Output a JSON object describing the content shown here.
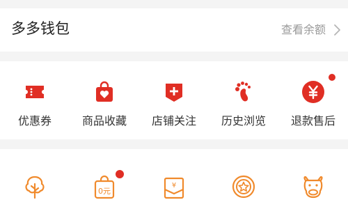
{
  "colors": {
    "brand_red": "#e02e24",
    "accent_orange": "#f08a2c",
    "background": "#f4f4f4",
    "text": "#333333",
    "muted": "#9a9a9a"
  },
  "wallet": {
    "title": "多多钱包",
    "link_label": "查看余额",
    "link_icon": "chevron-right-icon"
  },
  "shortcuts": [
    {
      "label": "优惠券",
      "icon": "coupon-icon",
      "badge": false
    },
    {
      "label": "商品收藏",
      "icon": "favorites-bag-icon",
      "badge": false
    },
    {
      "label": "店铺关注",
      "icon": "store-follow-icon",
      "badge": true
    },
    {
      "label": "历史浏览",
      "icon": "footprint-icon",
      "badge": false
    },
    {
      "label": "退款售后",
      "icon": "refund-yen-icon",
      "badge": false
    }
  ],
  "services": [
    {
      "icon": "tree-icon",
      "badge": false
    },
    {
      "icon": "zero-yuan-bag-icon",
      "badge": true,
      "icon_text": "0元"
    },
    {
      "icon": "yen-envelope-icon",
      "badge": false,
      "icon_text": "¥"
    },
    {
      "icon": "star-coin-icon",
      "badge": false
    },
    {
      "icon": "cow-icon",
      "badge": false
    }
  ]
}
